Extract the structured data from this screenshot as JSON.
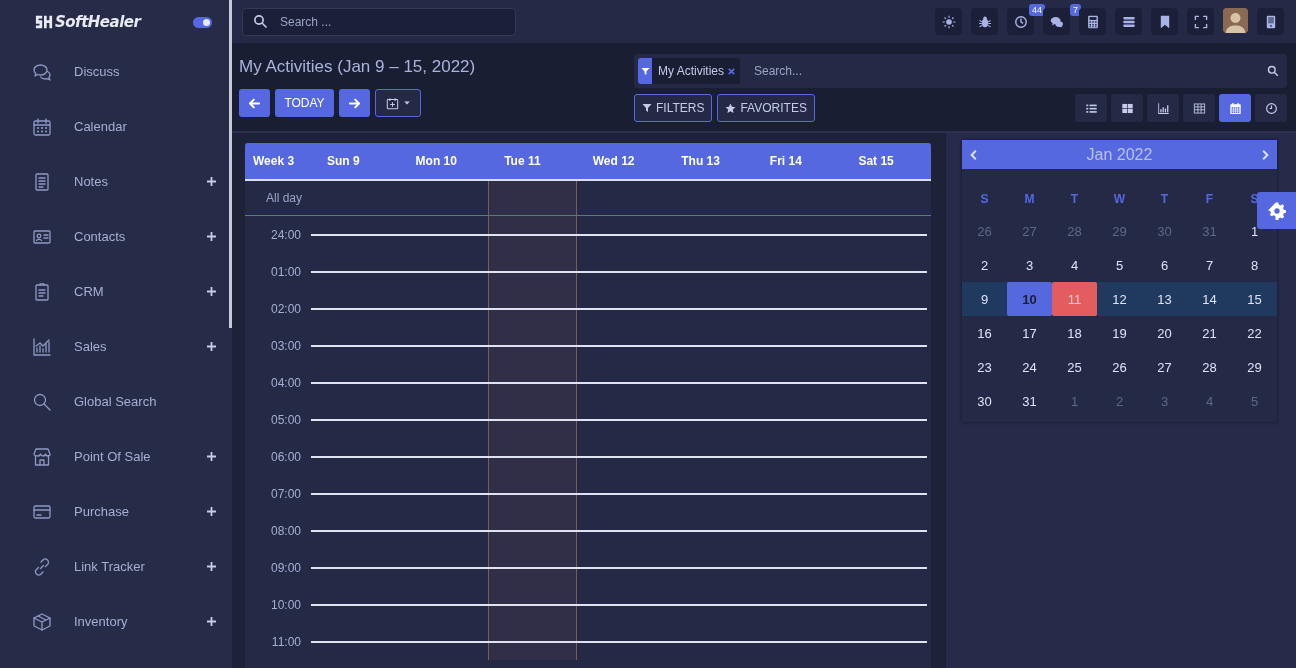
{
  "sidebar": {
    "logo": "SoftHealer",
    "toggle_on": true,
    "items": [
      {
        "label": "Discuss",
        "expandable": false
      },
      {
        "label": "Calendar",
        "expandable": false
      },
      {
        "label": "Notes",
        "expandable": true
      },
      {
        "label": "Contacts",
        "expandable": true
      },
      {
        "label": "CRM",
        "expandable": true
      },
      {
        "label": "Sales",
        "expandable": true
      },
      {
        "label": "Global Search",
        "expandable": false
      },
      {
        "label": "Point Of Sale",
        "expandable": true
      },
      {
        "label": "Purchase",
        "expandable": true
      },
      {
        "label": "Link Tracker",
        "expandable": true
      },
      {
        "label": "Inventory",
        "expandable": true
      }
    ]
  },
  "topbar": {
    "search_placeholder": "Search ...",
    "icons": [
      {
        "kind": "button"
      },
      {
        "kind": "button"
      },
      {
        "kind": "button",
        "badge": "44"
      },
      {
        "kind": "button",
        "badge": "7"
      },
      {
        "kind": "button"
      },
      {
        "kind": "button"
      },
      {
        "kind": "button"
      },
      {
        "kind": "button"
      },
      {
        "kind": "avatar"
      },
      {
        "kind": "button"
      }
    ]
  },
  "control_panel": {
    "title": "My Activities (Jan 9 – 15, 2022)",
    "today_label": "TODAY",
    "facet": {
      "label": "My Activities"
    },
    "search_placeholder": "Search...",
    "filters_label": "FILTERS",
    "favorites_label": "FAVORITES",
    "views": [
      {
        "selected": false
      },
      {
        "selected": false
      },
      {
        "selected": false
      },
      {
        "selected": false
      },
      {
        "selected": true
      },
      {
        "selected": false
      }
    ]
  },
  "week_view": {
    "week_label": "Week 3",
    "days": [
      {
        "label": "Sun 9",
        "today": false
      },
      {
        "label": "Mon 10",
        "today": false
      },
      {
        "label": "Tue 11",
        "today": true
      },
      {
        "label": "Wed 12",
        "today": false
      },
      {
        "label": "Thu 13",
        "today": false
      },
      {
        "label": "Fri 14",
        "today": false
      },
      {
        "label": "Sat 15",
        "today": false
      }
    ],
    "all_day_label": "All day",
    "hours": [
      "24:00",
      "01:00",
      "02:00",
      "03:00",
      "04:00",
      "05:00",
      "06:00",
      "07:00",
      "08:00",
      "09:00",
      "10:00",
      "11:00"
    ]
  },
  "mini_calendar": {
    "title": "Jan 2022",
    "weekdays": [
      "S",
      "M",
      "T",
      "W",
      "T",
      "F",
      "S"
    ],
    "weeks": [
      {
        "selected": false,
        "days": [
          {
            "label": "26",
            "muted": true,
            "selected": false,
            "today": false
          },
          {
            "label": "27",
            "muted": true,
            "selected": false,
            "today": false
          },
          {
            "label": "28",
            "muted": true,
            "selected": false,
            "today": false
          },
          {
            "label": "29",
            "muted": true,
            "selected": false,
            "today": false
          },
          {
            "label": "30",
            "muted": true,
            "selected": false,
            "today": false
          },
          {
            "label": "31",
            "muted": true,
            "selected": false,
            "today": false
          },
          {
            "label": "1",
            "muted": false,
            "selected": false,
            "today": false
          }
        ]
      },
      {
        "selected": false,
        "days": [
          {
            "label": "2",
            "muted": false,
            "selected": false,
            "today": false
          },
          {
            "label": "3",
            "muted": false,
            "selected": false,
            "today": false
          },
          {
            "label": "4",
            "muted": false,
            "selected": false,
            "today": false
          },
          {
            "label": "5",
            "muted": false,
            "selected": false,
            "today": false
          },
          {
            "label": "6",
            "muted": false,
            "selected": false,
            "today": false
          },
          {
            "label": "7",
            "muted": false,
            "selected": false,
            "today": false
          },
          {
            "label": "8",
            "muted": false,
            "selected": false,
            "today": false
          }
        ]
      },
      {
        "selected": true,
        "days": [
          {
            "label": "9",
            "muted": false,
            "selected": false,
            "today": false
          },
          {
            "label": "10",
            "muted": false,
            "selected": true,
            "today": false
          },
          {
            "label": "11",
            "muted": false,
            "selected": false,
            "today": true
          },
          {
            "label": "12",
            "muted": false,
            "selected": false,
            "today": false
          },
          {
            "label": "13",
            "muted": false,
            "selected": false,
            "today": false
          },
          {
            "label": "14",
            "muted": false,
            "selected": false,
            "today": false
          },
          {
            "label": "15",
            "muted": false,
            "selected": false,
            "today": false
          }
        ]
      },
      {
        "selected": false,
        "days": [
          {
            "label": "16",
            "muted": false,
            "selected": false,
            "today": false
          },
          {
            "label": "17",
            "muted": false,
            "selected": false,
            "today": false
          },
          {
            "label": "18",
            "muted": false,
            "selected": false,
            "today": false
          },
          {
            "label": "19",
            "muted": false,
            "selected": false,
            "today": false
          },
          {
            "label": "20",
            "muted": false,
            "selected": false,
            "today": false
          },
          {
            "label": "21",
            "muted": false,
            "selected": false,
            "today": false
          },
          {
            "label": "22",
            "muted": false,
            "selected": false,
            "today": false
          }
        ]
      },
      {
        "selected": false,
        "days": [
          {
            "label": "23",
            "muted": false,
            "selected": false,
            "today": false
          },
          {
            "label": "24",
            "muted": false,
            "selected": false,
            "today": false
          },
          {
            "label": "25",
            "muted": false,
            "selected": false,
            "today": false
          },
          {
            "label": "26",
            "muted": false,
            "selected": false,
            "today": false
          },
          {
            "label": "27",
            "muted": false,
            "selected": false,
            "today": false
          },
          {
            "label": "28",
            "muted": false,
            "selected": false,
            "today": false
          },
          {
            "label": "29",
            "muted": false,
            "selected": false,
            "today": false
          }
        ]
      },
      {
        "selected": false,
        "days": [
          {
            "label": "30",
            "muted": false,
            "selected": false,
            "today": false
          },
          {
            "label": "31",
            "muted": false,
            "selected": false,
            "today": false
          },
          {
            "label": "1",
            "muted": true,
            "selected": false,
            "today": false
          },
          {
            "label": "2",
            "muted": true,
            "selected": false,
            "today": false
          },
          {
            "label": "3",
            "muted": true,
            "selected": false,
            "today": false
          },
          {
            "label": "4",
            "muted": true,
            "selected": false,
            "today": false
          },
          {
            "label": "5",
            "muted": true,
            "selected": false,
            "today": false
          }
        ]
      }
    ]
  }
}
